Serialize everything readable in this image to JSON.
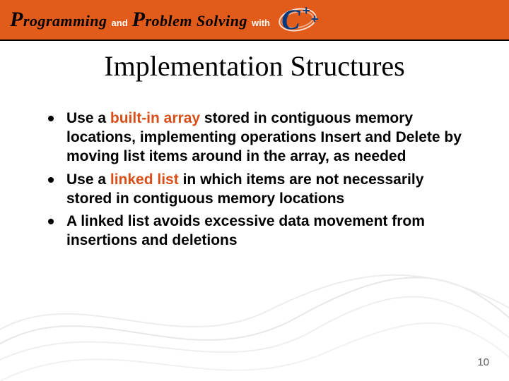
{
  "banner": {
    "word_programming": "Programming",
    "and": "and",
    "word_problem_solving": "Problem Solving",
    "with": "with",
    "cpp_c": "C",
    "cpp_plus1": "+",
    "cpp_plus2": "+"
  },
  "title": "Implementation Structures",
  "bullets": [
    {
      "pre": "Use a ",
      "hl": "built-in array",
      "post": " stored in contiguous memory locations, implementing operations Insert and Delete by moving list items around in the array, as needed"
    },
    {
      "pre": "Use a ",
      "hl": "linked list",
      "post": " in which items are not necessarily stored in contiguous memory locations"
    },
    {
      "pre": "",
      "hl": "",
      "post": "A linked list avoids excessive data movement from insertions and deletions"
    }
  ],
  "page_number": "10"
}
